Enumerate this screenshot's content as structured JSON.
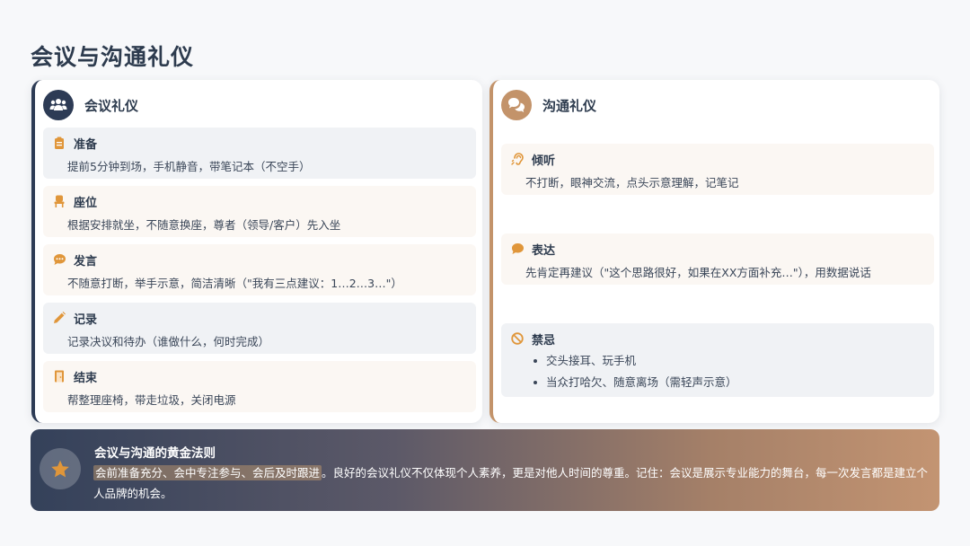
{
  "page": {
    "title": "会议与沟通礼仪"
  },
  "meeting": {
    "title": "会议礼仪",
    "icon": "users-icon",
    "items": [
      {
        "icon": "clipboard-icon",
        "title": "准备",
        "desc": "提前5分钟到场，手机静音，带笔记本（不空手）"
      },
      {
        "icon": "chair-icon",
        "title": "座位",
        "desc": "根据安排就坐，不随意换座，尊者（领导/客户）先入坐"
      },
      {
        "icon": "chat-bubble-icon",
        "title": "发言",
        "desc": "不随意打断，举手示意，简洁清晰（\"我有三点建议：1…2…3…\"）"
      },
      {
        "icon": "pencil-icon",
        "title": "记录",
        "desc": "记录决议和待办（谁做什么，何时完成）"
      },
      {
        "icon": "door-icon",
        "title": "结束",
        "desc": "帮整理座椅，带走垃圾，关闭电源"
      }
    ]
  },
  "communication": {
    "title": "沟通礼仪",
    "icon": "comments-icon",
    "items": [
      {
        "icon": "ear-icon",
        "title": "倾听",
        "desc": "不打断，眼神交流，点头示意理解，记笔记"
      },
      {
        "icon": "speech-icon",
        "title": "表达",
        "desc": "先肯定再建议（\"这个思路很好，如果在XX方面补充…\"），用数据说话"
      },
      {
        "icon": "ban-icon",
        "title": "禁忌",
        "bullets": [
          "交头接耳、玩手机",
          "当众打哈欠、随意离场（需轻声示意）"
        ]
      }
    ]
  },
  "banner": {
    "icon": "star-icon",
    "title": "会议与沟通的黄金法则",
    "highlight": "会前准备充分、会中专注参与、会后及时跟进",
    "text": "。良好的会议礼仪不仅体现个人素养，更是对他人时间的尊重。记住：会议是展示专业能力的舞台，每一次发言都是建立个人品牌的机会。"
  },
  "colors": {
    "navy": "#2d3b55",
    "accent": "#e0963a",
    "tan": "#c3936a"
  }
}
